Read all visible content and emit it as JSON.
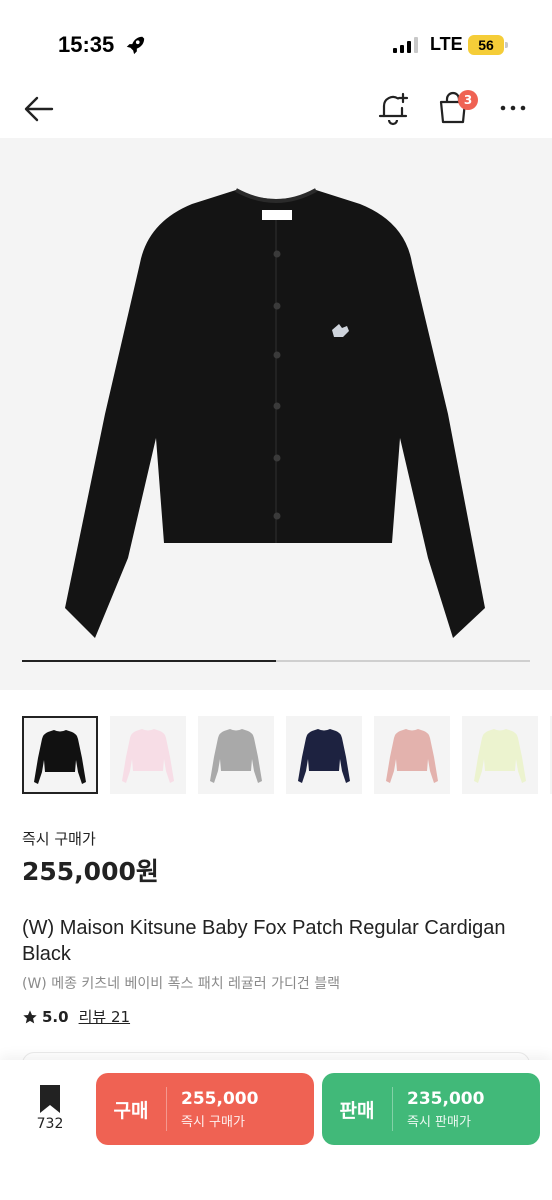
{
  "status_bar": {
    "time": "15:35",
    "network": "LTE",
    "battery": "56"
  },
  "nav": {
    "cart_badge": "3"
  },
  "gallery": {
    "progress": 0.5,
    "thumb_colors": [
      "#111111",
      "#f7dde6",
      "#a9a9a9",
      "#1d2240",
      "#e3b2ad",
      "#ecf3cf",
      "#e8e8e8"
    ]
  },
  "product": {
    "price_label": "즉시 구매가",
    "price": "255,000원",
    "title": "(W) Maison Kitsune Baby Fox Patch Regular Cardigan Black",
    "subtitle": "(W) 메종 키츠네 베이비 폭스 패치 레귤러 가디건 블랙",
    "rating": "5.0",
    "reviews": "리뷰 21"
  },
  "bottom_bar": {
    "wish_count": "732",
    "buy": {
      "label": "구매",
      "price": "255,000",
      "sub": "즉시 구매가"
    },
    "sell": {
      "label": "판매",
      "price": "235,000",
      "sub": "즉시 판매가"
    }
  }
}
